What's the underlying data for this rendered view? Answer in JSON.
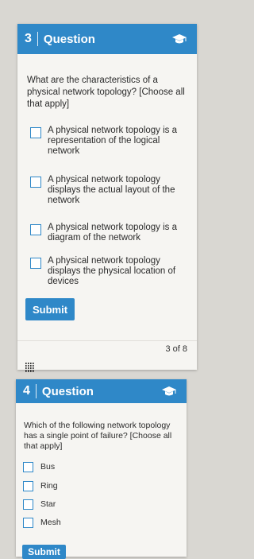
{
  "questions": [
    {
      "number": "3",
      "header": "Question",
      "prompt": "What are the characteristics of a physical network topology? [Choose all that apply]",
      "options": [
        "A physical network topology is a representation of the logical network",
        "A physical network topology displays the actual layout of the network",
        "A physical network topology is a diagram of the network",
        "A physical network topology displays the physical location of devices"
      ],
      "submit_label": "Submit",
      "page_indicator": "3 of 8"
    },
    {
      "number": "4",
      "header": "Question",
      "prompt": "Which of the following network topology has a single point of failure? [Choose all that apply]",
      "options": [
        "Bus",
        "Ring",
        "Star",
        "Mesh"
      ],
      "submit_label": "Submit"
    }
  ],
  "colors": {
    "accent": "#2f88c8",
    "card_bg": "#f6f5f2",
    "page_bg": "#d9d7d2"
  },
  "icons": {
    "header_icon": "graduation-cap-icon",
    "drag_icon": "drag-handle-icon"
  }
}
